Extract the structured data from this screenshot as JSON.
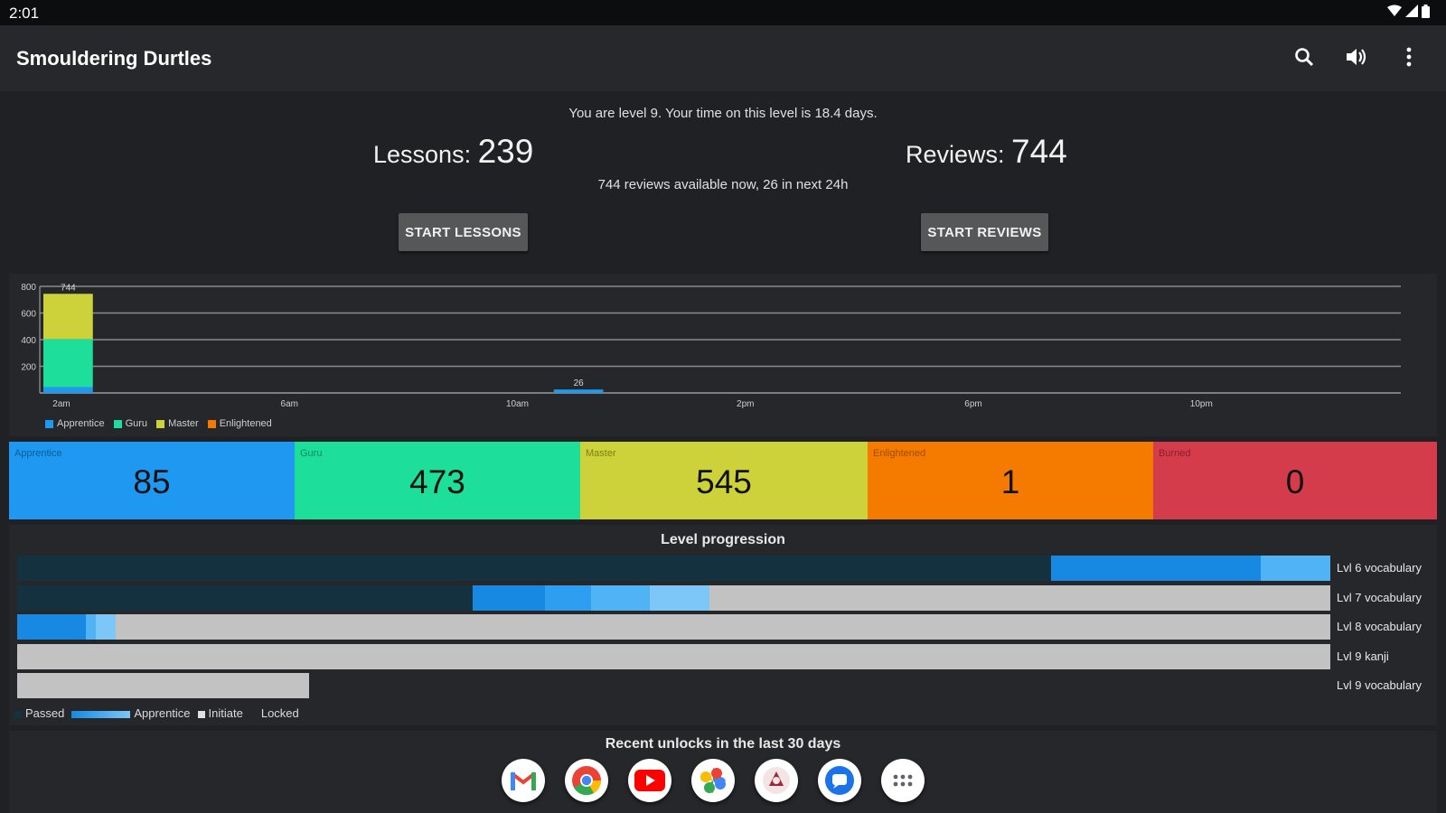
{
  "status": {
    "time": "2:01"
  },
  "app": {
    "title": "Smouldering Durtles",
    "icons": [
      "search-icon",
      "volume-icon",
      "more-vert-icon"
    ]
  },
  "summary": {
    "level_text": "You are level 9. Your time on this level is 18.4 days.",
    "lessons_label": "Lessons:",
    "lessons_count": "239",
    "reviews_label": "Reviews:",
    "reviews_count": "744",
    "availability": "744 reviews available now, 26 in next 24h",
    "start_lessons": "START LESSONS",
    "start_reviews": "START REVIEWS"
  },
  "colors": {
    "apprentice": "#1e98f0",
    "guru": "#1ede9c",
    "master": "#cdd23a",
    "enlightened": "#f57a00",
    "burned": "#d53c4b",
    "passed": "#13313f",
    "locked": "#c2c2c2"
  },
  "chart_data": {
    "type": "bar",
    "stacked": true,
    "x_ticks": [
      "2am",
      "6am",
      "10am",
      "2pm",
      "6pm",
      "10pm"
    ],
    "y_ticks": [
      "800",
      "600",
      "400",
      "200"
    ],
    "ylim": [
      0,
      800
    ],
    "grid": true,
    "legend_position": "bottom-left",
    "series_legend": [
      "Apprentice",
      "Guru",
      "Master",
      "Enlightened"
    ],
    "bars": [
      {
        "label": "744",
        "hour_index": 0,
        "apprentice": 44,
        "guru": 360,
        "master": 340,
        "enlightened": 0
      },
      {
        "label": "26",
        "hour_index": 9,
        "apprentice": 26,
        "guru": 0,
        "master": 0,
        "enlightened": 0
      }
    ]
  },
  "srs": [
    {
      "label": "Apprentice",
      "value": "85",
      "key": "apprentice"
    },
    {
      "label": "Guru",
      "value": "473",
      "key": "guru"
    },
    {
      "label": "Master",
      "value": "545",
      "key": "master"
    },
    {
      "label": "Enlightened",
      "value": "1",
      "key": "enlightened"
    },
    {
      "label": "Burned",
      "value": "0",
      "key": "burned"
    }
  ],
  "progression": {
    "title": "Level progression",
    "rows": [
      {
        "label": "Lvl 6 vocabulary",
        "segments": [
          {
            "c": "#13313f",
            "f": 0.787
          },
          {
            "c": "#1789e3",
            "f": 0.16
          },
          {
            "c": "#4fb3f5",
            "f": 0.053
          }
        ]
      },
      {
        "label": "Lvl 7 vocabulary",
        "segments": [
          {
            "c": "#13313f",
            "f": 0.347
          },
          {
            "c": "#1789e3",
            "f": 0.055
          },
          {
            "c": "#2e9ff0",
            "f": 0.035
          },
          {
            "c": "#4fb3f5",
            "f": 0.045
          },
          {
            "c": "#7cc6f8",
            "f": 0.045
          },
          {
            "c": "#c2c2c2",
            "f": 0.473
          }
        ]
      },
      {
        "label": "Lvl 8 vocabulary",
        "segments": [
          {
            "c": "#1789e3",
            "f": 0.052
          },
          {
            "c": "#4fb3f5",
            "f": 0.008
          },
          {
            "c": "#7cc6f8",
            "f": 0.015
          },
          {
            "c": "#c2c2c2",
            "f": 0.925
          }
        ]
      },
      {
        "label": "Lvl 9 kanji",
        "segments": [
          {
            "c": "#c2c2c2",
            "f": 1.0
          }
        ]
      },
      {
        "label": "Lvl 9 vocabulary",
        "segments": [
          {
            "c": "#c2c2c2",
            "f": 0.222
          }
        ]
      }
    ],
    "legend": {
      "passed": "Passed",
      "apprentice": "Apprentice",
      "initiate": "Initiate",
      "locked": "Locked"
    }
  },
  "unlocks": {
    "title": "Recent unlocks in the last 30 days"
  },
  "dock": [
    "gmail-icon",
    "chrome-icon",
    "youtube-icon",
    "photos-icon",
    "crab-app-icon",
    "messages-icon",
    "app-drawer-icon"
  ]
}
